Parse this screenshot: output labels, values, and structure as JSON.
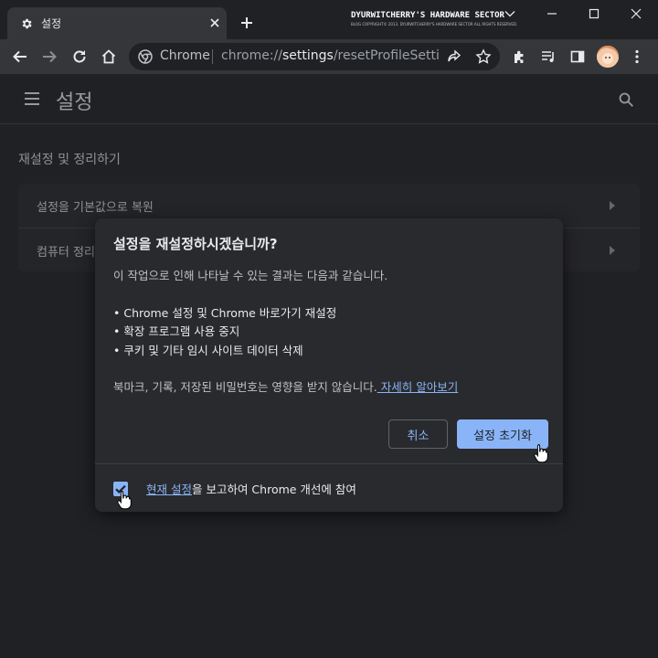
{
  "tab": {
    "title": "설정",
    "icon": "gear-icon"
  },
  "watermark": {
    "line1": "DYURWITCHERRY'S HARDWARE SECTOR",
    "line2": "BLOG COPYRIGHT© 2013. DYURWITCHERRY'S HARDWARE SECTOR ALL RIGHTS RESERVED."
  },
  "omnibox": {
    "site_label": "Chrome",
    "url_scheme": "chrome://",
    "url_host": "settings",
    "url_path": "/resetProfileSettin..."
  },
  "settings_header": {
    "title": "설정"
  },
  "page": {
    "section_title": "재설정 및 정리하기",
    "rows": [
      {
        "label": "설정을 기본값으로 복원"
      },
      {
        "label": "컴퓨터 정리"
      }
    ]
  },
  "dialog": {
    "title": "설정을 재설정하시겠습니까?",
    "intro": "이 작업으로 인해 나타날 수 있는 결과는 다음과 같습니다.",
    "bullets": [
      "• Chrome 설정 및 Chrome 바로가기 재설정",
      "• 확장 프로그램 사용 중지",
      "• 쿠키 및 기타 임시 사이트 데이터 삭제"
    ],
    "note": "북마크, 기록, 저장된 비밀번호는 영향을 받지 않습니다.",
    "learn_more": " 자세히 알아보기",
    "cancel_label": "취소",
    "reset_label": "설정 초기화",
    "footer_link": "현재 설정",
    "footer_text": "을 보고하여 Chrome 개선에 참여",
    "checkbox_checked": true
  },
  "colors": {
    "accent": "#8ab4f8",
    "background": "#202124",
    "surface": "#292a2d",
    "toolbar": "#35363a"
  }
}
